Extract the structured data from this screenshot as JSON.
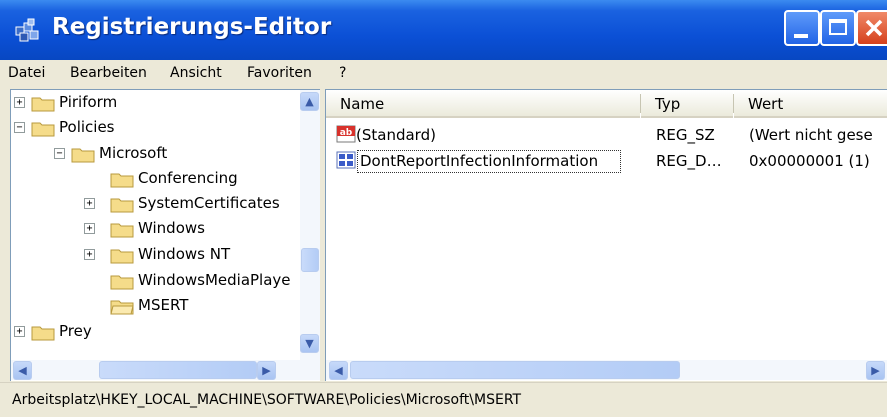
{
  "window": {
    "title": "Registrierungs-Editor"
  },
  "menu": [
    "Datei",
    "Bearbeiten",
    "Ansicht",
    "Favoriten",
    "?"
  ],
  "tree": [
    {
      "label": "Piriform",
      "expander": "+"
    },
    {
      "label": "Policies",
      "expander": "−"
    },
    {
      "label": "Microsoft",
      "expander": "−"
    },
    {
      "label": "Conferencing",
      "expander": ""
    },
    {
      "label": "SystemCertificates",
      "expander": "+"
    },
    {
      "label": "Windows",
      "expander": "+"
    },
    {
      "label": "Windows NT",
      "expander": "+"
    },
    {
      "label": "WindowsMediaPlaye",
      "expander": ""
    },
    {
      "label": "MSERT",
      "expander": ""
    },
    {
      "label": "Prey",
      "expander": "+"
    }
  ],
  "list": {
    "columns": [
      "Name",
      "Typ",
      "Wert"
    ],
    "rows": [
      {
        "name": "(Standard)",
        "type": "REG_SZ",
        "value": "(Wert nicht gese",
        "icon": "string-value-icon"
      },
      {
        "name": "DontReportInfectionInformation",
        "type": "REG_D…",
        "value": "0x00000001 (1)",
        "icon": "dword-value-icon"
      }
    ]
  },
  "status": {
    "path": "Arbeitsplatz\\HKEY_LOCAL_MACHINE\\SOFTWARE\\Policies\\Microsoft\\MSERT"
  },
  "colors": {
    "titlebar": "#0B50D6",
    "close_button": "#D5401C",
    "folder": "#F5DC8A",
    "chrome": "#ECE9D8"
  }
}
